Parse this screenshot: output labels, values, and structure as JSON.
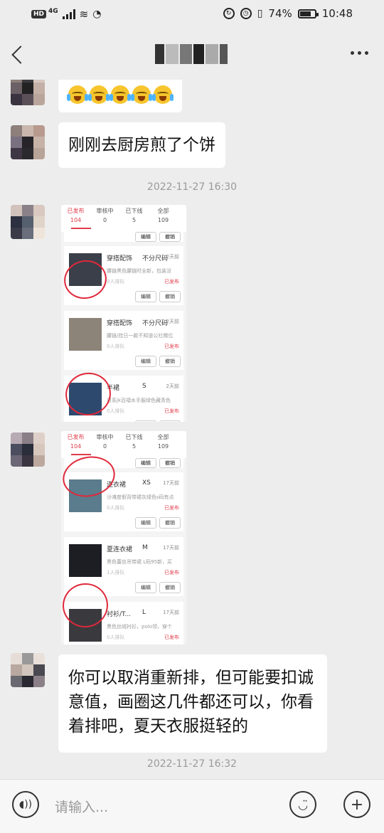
{
  "status_bar": {
    "network_badge": "HD",
    "network_type": "4G",
    "battery_percent": 74,
    "battery_label": "74%",
    "time": "10:48"
  },
  "nav": {
    "title_obscured": true
  },
  "messages": {
    "emoji_count": 5,
    "text_1": "刚刚去厨房煎了个饼",
    "timestamp_1": "2022-11-27 16:30",
    "text_2": "你可以取消重新排，但可能要扣诚意值，画圈这几件都还可以，你看着排吧，夏天衣服挺轻的",
    "timestamp_2": "2022-11-27 16:32"
  },
  "shot1": {
    "tabs": [
      {
        "label": "已发布",
        "count": "104"
      },
      {
        "label": "审核中",
        "count": "0"
      },
      {
        "label": "已下线",
        "count": "5"
      },
      {
        "label": "全部",
        "count": "109"
      }
    ],
    "edit_label": "编辑",
    "cancel_label": "撤销",
    "items": [
      {
        "title": "穿搭配饰",
        "size": "不分尺码",
        "time": "2天前",
        "desc": "腰链黑色腰链时全新，包装没",
        "queue": "0人排队",
        "status": "已发布"
      },
      {
        "title": "穿搭配饰",
        "size": "不分尺码",
        "time": "2天前",
        "desc": "腰链/挂日一款不知道公社赠位",
        "queue": "0人排队",
        "status": "已发布"
      },
      {
        "title": "半裙",
        "size": "S",
        "time": "2天前",
        "desc": "日系jk百褶水手服绿色藏青色",
        "queue": "0人排队",
        "status": "已发布"
      }
    ]
  },
  "shot2": {
    "tabs": [
      {
        "label": "已发布",
        "count": "104"
      },
      {
        "label": "审核中",
        "count": "0"
      },
      {
        "label": "已下线",
        "count": "5"
      },
      {
        "label": "全部",
        "count": "109"
      }
    ],
    "edit_label": "编辑",
    "cancel_label": "撤销",
    "items": [
      {
        "title": "连衣裙",
        "size": "XS",
        "time": "17天前",
        "desc": "沙滩度假背带裙灰绿色s码有点",
        "queue": "0人排队",
        "status": "已发布"
      },
      {
        "title": "夏连衣裙",
        "size": "M",
        "time": "17天前",
        "desc": "黑色蕾丝吊带裙 L码95新，买",
        "queue": "1人排队",
        "status": "已发布"
      },
      {
        "title": "衬衫/T...",
        "size": "L",
        "time": "17天前",
        "desc": "黑色丝绒衬衫，polo领，穿个",
        "queue": "0人排队",
        "status": "已发布"
      }
    ]
  },
  "input_bar": {
    "placeholder": "请输入..."
  },
  "colors": {
    "background": "#ededed",
    "bubble": "#ffffff",
    "accent_red": "#e03c4a"
  }
}
